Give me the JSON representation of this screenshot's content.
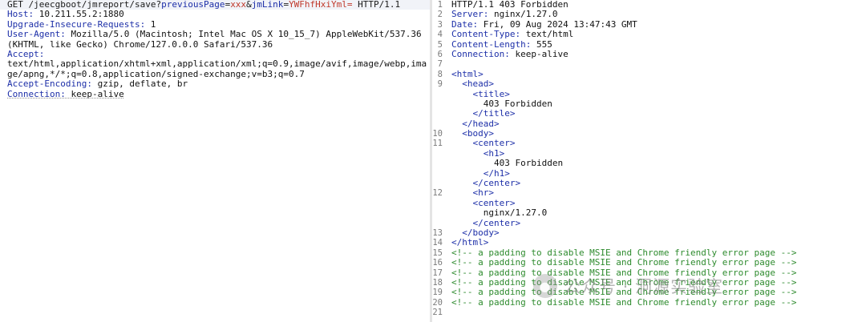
{
  "request": {
    "method": "GET",
    "path": "/jeecgboot/jmreport/save?",
    "params": [
      {
        "name": "previousPage",
        "value": "xxx",
        "sep": ""
      },
      {
        "name": "jmLink",
        "value": "YWFhfHxiYml=",
        "sep": "&"
      }
    ],
    "protocol": "HTTP/1.1",
    "headers": [
      {
        "key": "Host:",
        "value": " 10.211.55.2:1880"
      },
      {
        "key": "Upgrade-Insecure-Requests:",
        "value": " 1"
      },
      {
        "key": "User-Agent:",
        "value": " Mozilla/5.0 (Macintosh; Intel Mac OS X 10_15_7) AppleWebKit/537.36"
      },
      {
        "key": "",
        "value": "(KHTML, like Gecko) Chrome/127.0.0.0 Safari/537.36"
      },
      {
        "key": "Accept:",
        "value": ""
      },
      {
        "key": "",
        "value": "text/html,application/xhtml+xml,application/xml;q=0.9,image/avif,image/webp,ima"
      },
      {
        "key": "",
        "value": "ge/apng,*/*;q=0.8,application/signed-exchange;v=b3;q=0.7"
      },
      {
        "key": "Accept-Encoding:",
        "value": " gzip, deflate, br"
      },
      {
        "key": "Connection:",
        "value": " keep-alive"
      }
    ]
  },
  "response": {
    "lines": [
      {
        "n": "1",
        "kind": "status",
        "text": "HTTP/1.1 403 Forbidden"
      },
      {
        "n": "2",
        "kind": "header",
        "key": "Server:",
        "value": " nginx/1.27.0"
      },
      {
        "n": "3",
        "kind": "header",
        "key": "Date:",
        "value": " Fri, 09 Aug 2024 13:47:43 GMT"
      },
      {
        "n": "4",
        "kind": "header",
        "key": "Content-Type:",
        "value": " text/html"
      },
      {
        "n": "5",
        "kind": "header",
        "key": "Content-Length:",
        "value": " 555"
      },
      {
        "n": "6",
        "kind": "header",
        "key": "Connection:",
        "value": " keep-alive"
      },
      {
        "n": "7",
        "kind": "blank",
        "text": ""
      },
      {
        "n": "8",
        "kind": "tag",
        "text": "<html>"
      },
      {
        "n": "9",
        "kind": "tag",
        "text": "  <head>"
      },
      {
        "n": "",
        "kind": "tag",
        "text": "    <title>"
      },
      {
        "n": "",
        "kind": "text",
        "text": "      403 Forbidden"
      },
      {
        "n": "",
        "kind": "tag",
        "text": "    </title>"
      },
      {
        "n": "",
        "kind": "tag",
        "text": "  </head>"
      },
      {
        "n": "10",
        "kind": "tag",
        "text": "  <body>"
      },
      {
        "n": "11",
        "kind": "tag",
        "text": "    <center>"
      },
      {
        "n": "",
        "kind": "tag",
        "text": "      <h1>"
      },
      {
        "n": "",
        "kind": "text",
        "text": "        403 Forbidden"
      },
      {
        "n": "",
        "kind": "tag",
        "text": "      </h1>"
      },
      {
        "n": "",
        "kind": "tag",
        "text": "    </center>"
      },
      {
        "n": "12",
        "kind": "tag",
        "text": "    <hr>"
      },
      {
        "n": "",
        "kind": "tag",
        "text": "    <center>"
      },
      {
        "n": "",
        "kind": "text",
        "text": "      nginx/1.27.0"
      },
      {
        "n": "",
        "kind": "tag",
        "text": "    </center>"
      },
      {
        "n": "13",
        "kind": "tag",
        "text": "  </body>"
      },
      {
        "n": "14",
        "kind": "tag",
        "text": "</html>"
      },
      {
        "n": "15",
        "kind": "comment",
        "text": "<!-- a padding to disable MSIE and Chrome friendly error page -->"
      },
      {
        "n": "16",
        "kind": "comment",
        "text": "<!-- a padding to disable MSIE and Chrome friendly error page -->"
      },
      {
        "n": "17",
        "kind": "comment",
        "text": "<!-- a padding to disable MSIE and Chrome friendly error page -->"
      },
      {
        "n": "18",
        "kind": "comment",
        "text": "<!-- a padding to disable MSIE and Chrome friendly error page -->"
      },
      {
        "n": "19",
        "kind": "comment",
        "text": "<!-- a padding to disable MSIE and Chrome friendly error page -->"
      },
      {
        "n": "20",
        "kind": "comment",
        "text": "<!-- a padding to disable MSIE and Chrome friendly error page -->"
      },
      {
        "n": "21",
        "kind": "blank",
        "text": ""
      }
    ]
  },
  "watermark": {
    "text": "公众号 · 洞源实验室",
    "icon": "wechat-logo-icon"
  },
  "colors": {
    "header_key": "#1d2fa8",
    "param_value": "#c0392b",
    "comment": "#2e8b2e"
  }
}
